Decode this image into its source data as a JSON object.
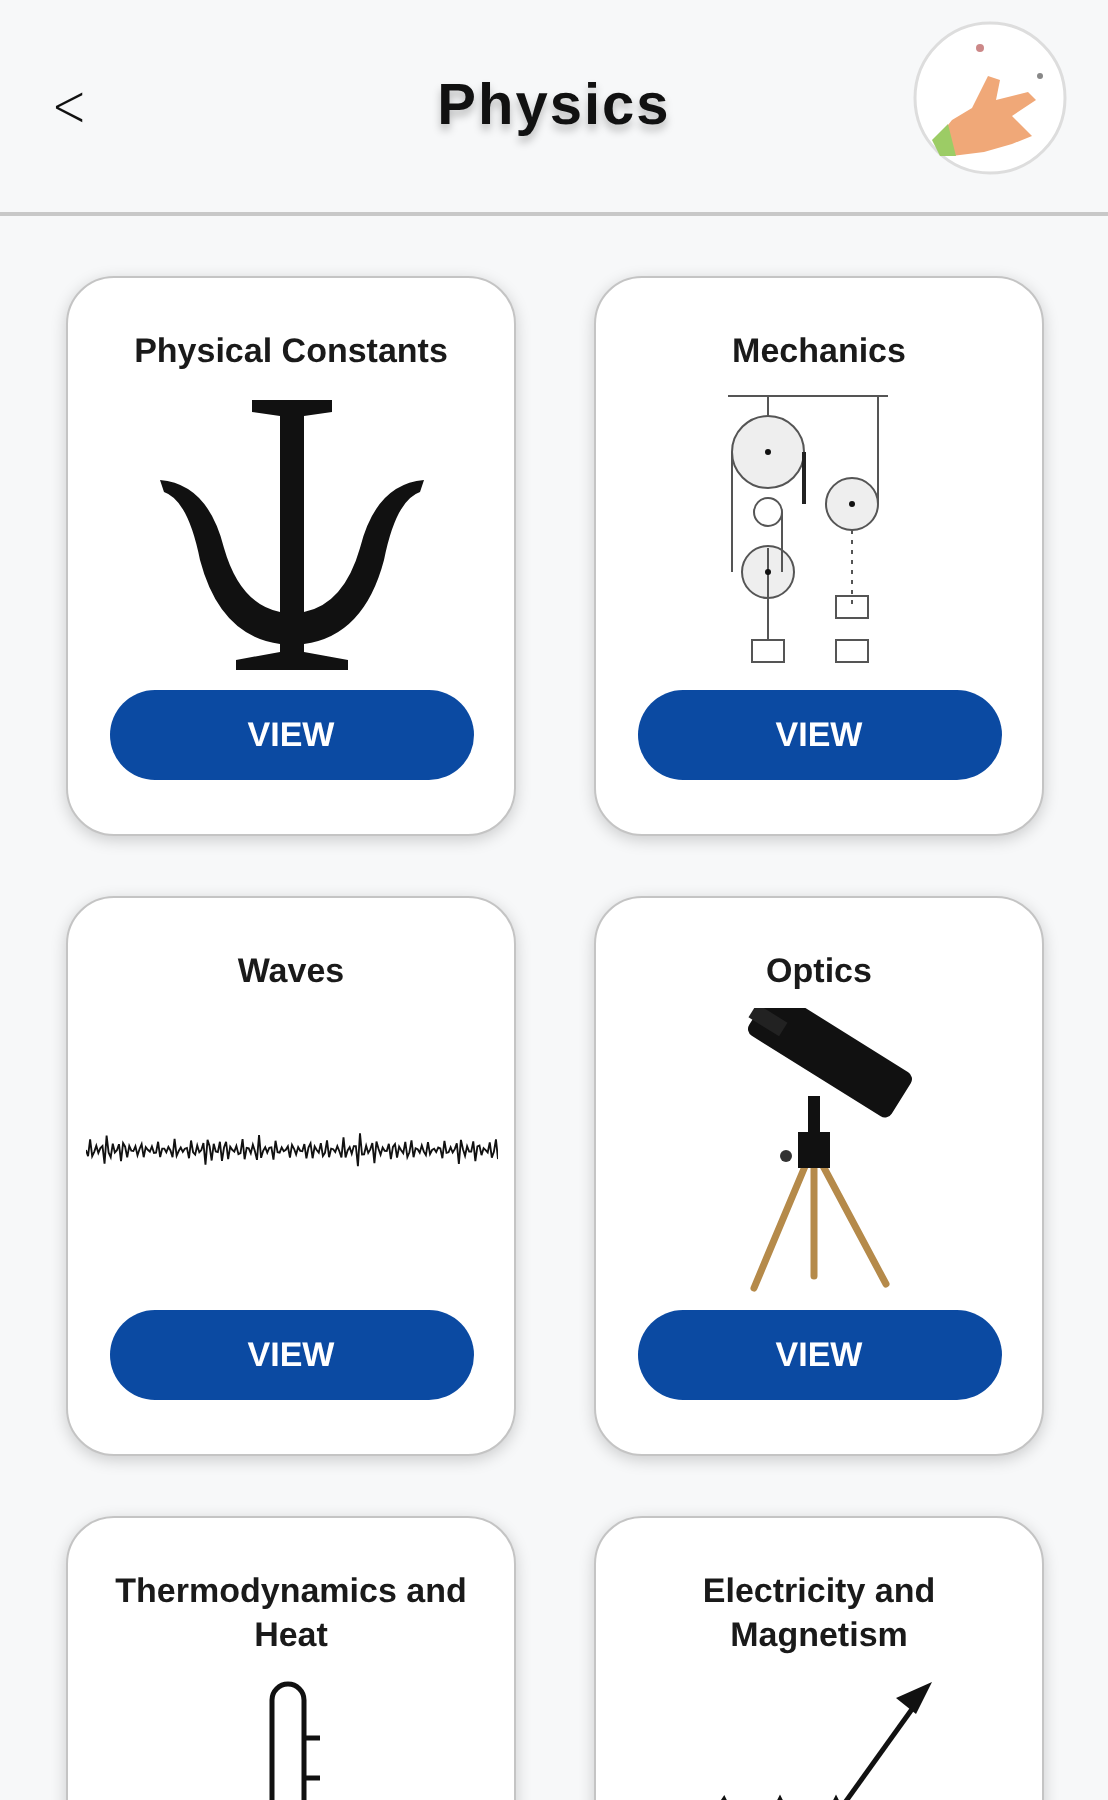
{
  "header": {
    "back": "<",
    "title": "Physics"
  },
  "cards": [
    {
      "title": "Physical Constants",
      "kind": "psi",
      "button": "VIEW"
    },
    {
      "title": "Mechanics",
      "kind": "pulleys",
      "button": "VIEW"
    },
    {
      "title": "Waves",
      "kind": "wave",
      "button": "VIEW"
    },
    {
      "title": "Optics",
      "kind": "telescope",
      "button": "VIEW"
    },
    {
      "title": "Thermodynamics and Heat",
      "kind": "thermometer"
    },
    {
      "title": "Electricity and Magnetism",
      "kind": "resistor"
    }
  ]
}
